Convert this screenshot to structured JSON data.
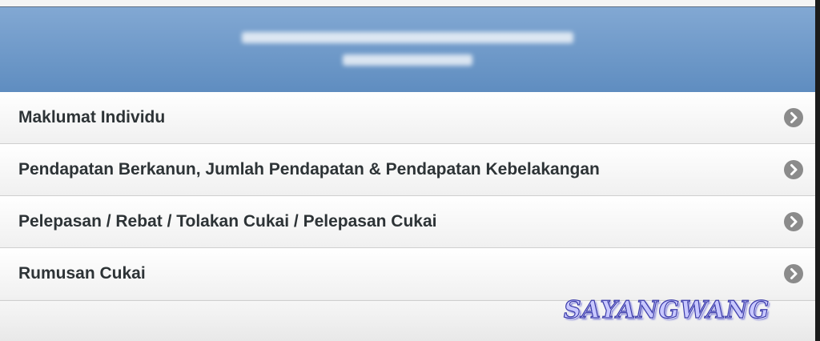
{
  "header": {
    "line1": "",
    "line2": ""
  },
  "menu": {
    "items": [
      {
        "label": "Maklumat Individu"
      },
      {
        "label": "Pendapatan Berkanun, Jumlah Pendapatan & Pendapatan Kebelakangan"
      },
      {
        "label": "Pelepasan / Rebat / Tolakan Cukai / Pelepasan Cukai"
      },
      {
        "label": "Rumusan Cukai"
      }
    ],
    "chevron_icon": "chevron-right-circle-icon"
  },
  "watermark": {
    "text": "SAYANGWANG"
  },
  "colors": {
    "header_top": "#82a8d3",
    "header_bottom": "#5f8dc0",
    "label_text": "#2d3336",
    "chevron_bg": "#8b8b8b"
  }
}
